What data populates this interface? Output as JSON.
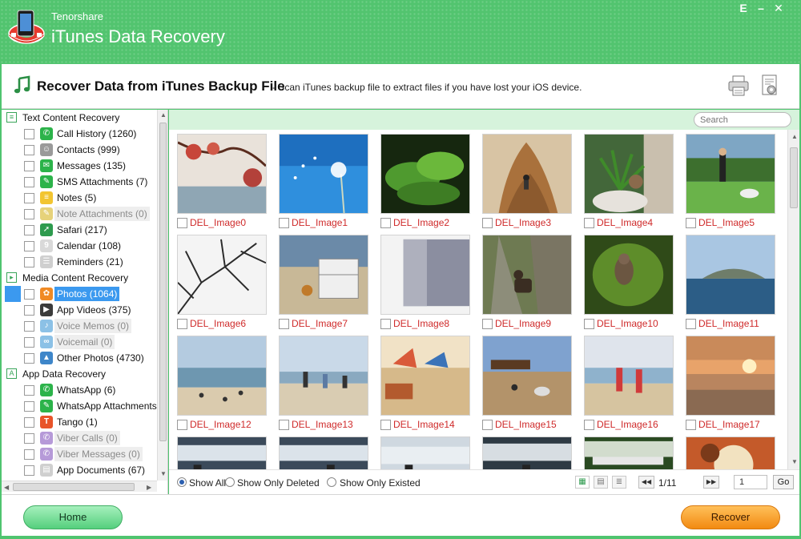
{
  "window": {
    "brand": "Tenorshare",
    "title": "iTunes Data Recovery",
    "menu_label": "E",
    "minimize_label": "–",
    "close_label": "✕"
  },
  "header": {
    "title": "Recover Data from iTunes Backup File",
    "subtitle": "- Scan iTunes backup file to extract files if you have lost your iOS device.",
    "icons": [
      "music-note-icon",
      "printer-icon",
      "settings-document-icon"
    ]
  },
  "sidebar": {
    "categories": [
      {
        "label": "Text Content Recovery",
        "items": [
          {
            "label": "Call History (1260)",
            "icon": "phone-icon",
            "color": "#2cb34a",
            "enabled": true
          },
          {
            "label": "Contacts (999)",
            "icon": "contacts-icon",
            "color": "#9a9a9a",
            "enabled": true
          },
          {
            "label": "Messages (135)",
            "icon": "message-icon",
            "color": "#2cb34a",
            "enabled": true
          },
          {
            "label": "SMS Attachments (7)",
            "icon": "attachment-icon",
            "color": "#2cb34a",
            "enabled": true
          },
          {
            "label": "Notes (5)",
            "icon": "notes-icon",
            "color": "#f2c531",
            "enabled": true
          },
          {
            "label": "Note Attachments (0)",
            "icon": "note-attachment-icon",
            "color": "#e6d27a",
            "enabled": false
          },
          {
            "label": "Safari (217)",
            "icon": "safari-icon",
            "color": "#2e9b4e",
            "enabled": true
          },
          {
            "label": "Calendar (108)",
            "icon": "calendar-icon",
            "color": "#d9d9d9",
            "enabled": true
          },
          {
            "label": "Reminders (21)",
            "icon": "reminders-icon",
            "color": "#cfcfcf",
            "enabled": true
          }
        ]
      },
      {
        "label": "Media Content Recovery",
        "items": [
          {
            "label": "Photos (1064)",
            "icon": "photos-icon",
            "color": "#f08a24",
            "enabled": true,
            "selected": true
          },
          {
            "label": "App Videos (375)",
            "icon": "video-icon",
            "color": "#3b3b3b",
            "enabled": true
          },
          {
            "label": "Voice Memos (0)",
            "icon": "microphone-icon",
            "color": "#8cc1e6",
            "enabled": false
          },
          {
            "label": "Voicemail (0)",
            "icon": "voicemail-icon",
            "color": "#8cc1e6",
            "enabled": false
          },
          {
            "label": "Other Photos (4730)",
            "icon": "landscape-icon",
            "color": "#3e86c9",
            "enabled": true
          }
        ]
      },
      {
        "label": "App Data Recovery",
        "items": [
          {
            "label": "WhatsApp (6)",
            "icon": "whatsapp-icon",
            "color": "#2cb34a",
            "enabled": true
          },
          {
            "label": "WhatsApp Attachments (",
            "icon": "attachment-icon",
            "color": "#2cb34a",
            "enabled": true
          },
          {
            "label": "Tango (1)",
            "icon": "tango-icon",
            "color": "#e8542a",
            "enabled": true
          },
          {
            "label": "Viber Calls (0)",
            "icon": "viber-icon",
            "color": "#b69ad8",
            "enabled": false
          },
          {
            "label": "Viber Messages (0)",
            "icon": "viber-icon",
            "color": "#b69ad8",
            "enabled": false
          },
          {
            "label": "App Documents (67)",
            "icon": "document-icon",
            "color": "#cfcfcf",
            "enabled": true
          }
        ]
      }
    ]
  },
  "content": {
    "search_placeholder": "Search",
    "images": [
      "DEL_Image0",
      "DEL_Image1",
      "DEL_Image2",
      "DEL_Image3",
      "DEL_Image4",
      "DEL_Image5",
      "DEL_Image6",
      "DEL_Image7",
      "DEL_Image8",
      "DEL_Image9",
      "DEL_Image10",
      "DEL_Image11",
      "DEL_Image12",
      "DEL_Image13",
      "DEL_Image14",
      "DEL_Image15",
      "DEL_Image16",
      "DEL_Image17"
    ],
    "filters": {
      "show_all": "Show All",
      "show_deleted": "Show Only Deleted",
      "show_existed": "Show Only Existed",
      "selected": "show_all"
    },
    "pagination": {
      "indicator": "1/11",
      "page_value": "1",
      "go_label": "Go"
    }
  },
  "footer": {
    "home_label": "Home",
    "recover_label": "Recover"
  }
}
